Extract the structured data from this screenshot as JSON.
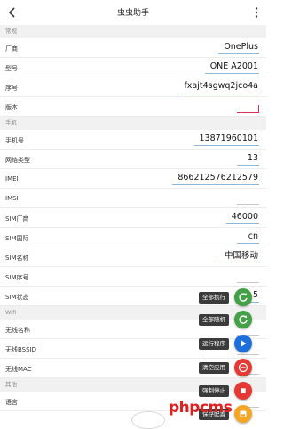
{
  "header": {
    "title": "虫虫助手"
  },
  "sections": [
    {
      "title": "常规",
      "rows": [
        {
          "label": "厂商",
          "value": "OnePlus"
        },
        {
          "label": "型号",
          "value": "ONE A2001"
        },
        {
          "label": "序号",
          "value": "fxajt4sgwq2jco4a"
        },
        {
          "label": "版本",
          "value": ""
        }
      ]
    },
    {
      "title": "手机",
      "rows": [
        {
          "label": "手机号",
          "value": "13871960101"
        },
        {
          "label": "网络类型",
          "value": "13"
        },
        {
          "label": "IMEI",
          "value": "866212576212579"
        },
        {
          "label": "IMSI",
          "value": ""
        },
        {
          "label": "SIM厂商",
          "value": "46000"
        },
        {
          "label": "SIM国际",
          "value": "cn"
        },
        {
          "label": "SIM名称",
          "value": "中国移动"
        },
        {
          "label": "SIM序号",
          "value": ""
        },
        {
          "label": "SIM状态",
          "value": "5"
        }
      ]
    },
    {
      "title": "Wifi",
      "rows": [
        {
          "label": "无线名称",
          "value": ""
        },
        {
          "label": "无线BSSID",
          "value": ""
        },
        {
          "label": "无线MAC",
          "value": ""
        }
      ]
    },
    {
      "title": "其他",
      "rows": [
        {
          "label": "语言",
          "value": ""
        }
      ]
    }
  ],
  "actions": [
    {
      "label": "全部执行",
      "icon": "refresh-icon",
      "color": "#43a047"
    },
    {
      "label": "全部随机",
      "icon": "refresh-icon",
      "color": "#43a047"
    },
    {
      "label": "运行程序",
      "icon": "play-icon",
      "color": "#1e6fd9"
    },
    {
      "label": "清空应用",
      "icon": "minus-circle-icon",
      "color": "#e53935"
    },
    {
      "label": "强制停止",
      "icon": "stop-icon",
      "color": "#e53935"
    },
    {
      "label": "保存配置",
      "icon": "save-icon",
      "color": "#f5a623"
    }
  ],
  "watermark": "phpcms"
}
